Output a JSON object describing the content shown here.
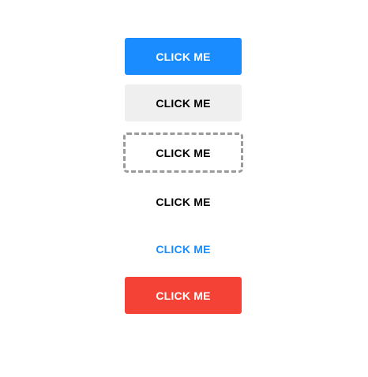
{
  "buttons": [
    {
      "label": "CLICK ME",
      "variant": "primary",
      "color": "#1a8cff"
    },
    {
      "label": "CLICK ME",
      "variant": "default",
      "color": "#efefef"
    },
    {
      "label": "CLICK ME",
      "variant": "dashed",
      "color": "#9a9a9a"
    },
    {
      "label": "CLICK ME",
      "variant": "text",
      "color": "#000000"
    },
    {
      "label": "CLICK ME",
      "variant": "link",
      "color": "#1a8cff"
    },
    {
      "label": "CLICK ME",
      "variant": "danger",
      "color": "#f44336"
    }
  ]
}
